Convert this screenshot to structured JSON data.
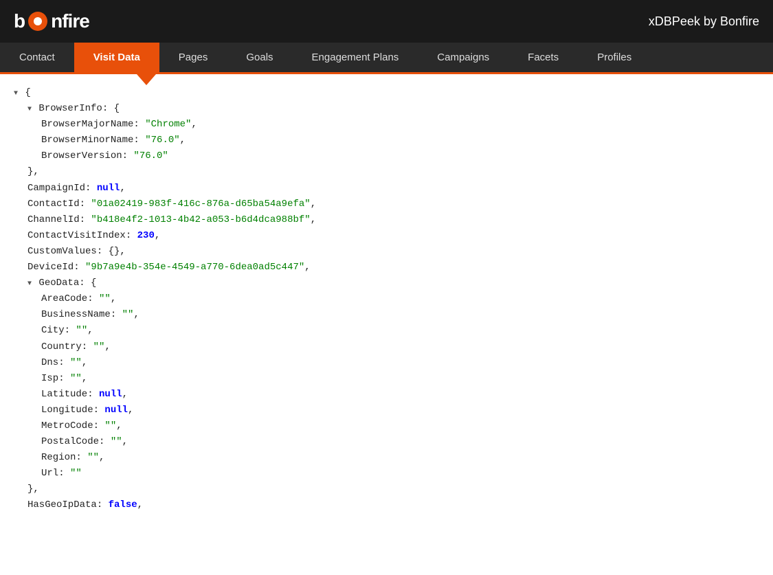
{
  "header": {
    "logo_bold": "b",
    "logo_rest": "nfire",
    "app_title": "xDBPeek by Bonfire"
  },
  "nav": {
    "items": [
      {
        "id": "contact",
        "label": "Contact",
        "active": false
      },
      {
        "id": "visit-data",
        "label": "Visit Data",
        "active": true
      },
      {
        "id": "pages",
        "label": "Pages",
        "active": false
      },
      {
        "id": "goals",
        "label": "Goals",
        "active": false
      },
      {
        "id": "engagement-plans",
        "label": "Engagement Plans",
        "active": false
      },
      {
        "id": "campaigns",
        "label": "Campaigns",
        "active": false
      },
      {
        "id": "facets",
        "label": "Facets",
        "active": false
      },
      {
        "id": "profiles",
        "label": "Profiles",
        "active": false
      }
    ]
  },
  "json_data": {
    "BrowserInfo": {
      "BrowserMajorName": "Chrome",
      "BrowserMinorName": "76.0",
      "BrowserVersion": "76.0"
    },
    "CampaignId": null,
    "ContactId": "01a02419-983f-416c-876a-d65ba54a9efa",
    "ChannelId": "b418e4f2-1013-4b42-a053-b6d4dca988bf",
    "ContactVisitIndex": 230,
    "CustomValues": {},
    "DeviceId": "9b7a9e4b-354e-4549-a770-6dea0ad5c447",
    "GeoData": {
      "AreaCode": "",
      "BusinessName": "",
      "City": "",
      "Country": "",
      "Dns": "",
      "Isp": "",
      "Latitude": null,
      "Longitude": null,
      "MetroCode": "",
      "PostalCode": "",
      "Region": "",
      "Url": ""
    },
    "HasGeoIpData": false
  }
}
